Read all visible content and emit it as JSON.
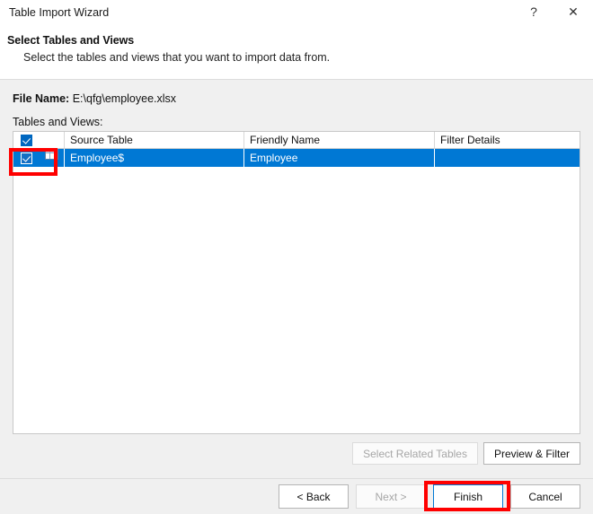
{
  "window": {
    "title": "Table Import Wizard",
    "help_icon": "question-mark-icon",
    "close_icon": "close-icon",
    "help_label": "?",
    "close_label": "✕"
  },
  "header": {
    "title": "Select Tables and Views",
    "subtitle": "Select the tables and views that you want to import data from."
  },
  "file": {
    "label": "File Name:",
    "path": "E:\\qfg\\employee.xlsx"
  },
  "list": {
    "caption": "Tables and Views:",
    "select_all_checked": true,
    "columns": [
      {
        "key": "source",
        "label": "Source Table"
      },
      {
        "key": "friendly",
        "label": "Friendly Name"
      },
      {
        "key": "filter",
        "label": "Filter Details"
      }
    ],
    "rows": [
      {
        "checked": true,
        "icon": "table-grid-icon",
        "source": "Employee$",
        "friendly": "Employee",
        "filter": "",
        "selected": true
      }
    ]
  },
  "mid_buttons": {
    "select_related_tables": {
      "label": "Select Related Tables",
      "enabled": false
    },
    "preview_filter": {
      "label": "Preview & Filter",
      "enabled": true
    }
  },
  "footer_buttons": {
    "back": {
      "label": "< Back",
      "enabled": true
    },
    "next": {
      "label": "Next >",
      "enabled": false
    },
    "finish": {
      "label": "Finish",
      "enabled": true,
      "focused": true
    },
    "cancel": {
      "label": "Cancel",
      "enabled": true
    }
  },
  "annotations": {
    "accent_red": "#ff0000",
    "selection_blue": "#0078d4",
    "checkbox_blue": "#0067c0"
  }
}
